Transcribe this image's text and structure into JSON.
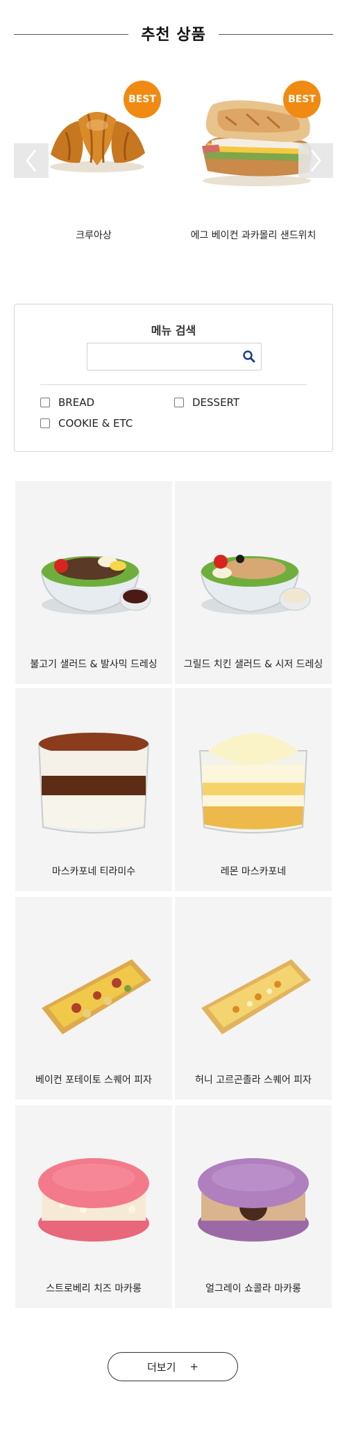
{
  "recommended": {
    "title": "추천 상품",
    "items": [
      {
        "name": "크루아상",
        "badge": "BEST",
        "image": "croissant"
      },
      {
        "name": "에그 베이컨 과카몰리 샌드위치",
        "badge": "BEST",
        "image": "sandwich"
      }
    ],
    "prev_icon": "chevron-left-icon",
    "next_icon": "chevron-right-icon"
  },
  "search": {
    "title": "메뉴 검색",
    "value": "",
    "placeholder": "",
    "icon": "search-icon",
    "categories": [
      {
        "label": "BREAD",
        "checked": false
      },
      {
        "label": "DESSERT",
        "checked": false
      },
      {
        "label": "COOKIE & ETC",
        "checked": false
      }
    ]
  },
  "products": [
    {
      "name": "불고기 샐러드 & 발사믹 드레싱",
      "image": "bulgogi-salad"
    },
    {
      "name": "그릴드 치킨 샐러드 & 시저 드레싱",
      "image": "chicken-salad"
    },
    {
      "name": "마스카포네 티라미수",
      "image": "tiramisu"
    },
    {
      "name": "레몬 마스카포네",
      "image": "lemon-mascarpone"
    },
    {
      "name": "베이컨 포테이토 스퀘어 피자",
      "image": "bacon-pizza"
    },
    {
      "name": "허니 고르곤졸라 스퀘어 피자",
      "image": "honey-pizza"
    },
    {
      "name": "스트로베리 치즈 마카롱",
      "image": "strawberry-macaron"
    },
    {
      "name": "얼그레이 쇼콜라 마카롱",
      "image": "earlgrey-macaron"
    }
  ],
  "more_button": {
    "label": "더보기",
    "plus": "+"
  },
  "colors": {
    "badge": "#f08a12",
    "card_bg": "#f4f4f4",
    "search_icon": "#1f3c88"
  }
}
